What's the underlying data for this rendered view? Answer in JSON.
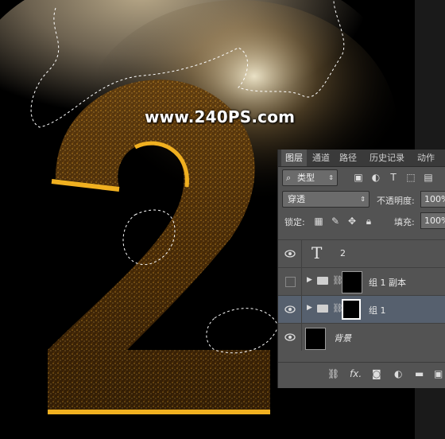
{
  "watermark": "www.240PS.com",
  "panel": {
    "tabs": [
      "图层",
      "通道",
      "路径",
      "历史记录",
      "动作"
    ],
    "filter_label": "类型",
    "blend_mode": "穿透",
    "opacity_label": "不透明度:",
    "opacity_value": "100%",
    "lock_label": "锁定:",
    "fill_label": "填充:",
    "fill_value": "100%",
    "layers": [
      {
        "name": "2",
        "kind": "text",
        "visible": true
      },
      {
        "name": "组 1 副本",
        "kind": "group",
        "visible": false
      },
      {
        "name": "组 1",
        "kind": "group",
        "visible": true,
        "selected": true
      },
      {
        "name": "背景",
        "kind": "background",
        "visible": true
      }
    ],
    "footer_icons": [
      "link-icon",
      "fx-icon",
      "mask-icon",
      "adjustment-icon",
      "folder-icon",
      "new-layer-icon"
    ]
  },
  "colors": {
    "panel_bg": "#535353",
    "selected_layer": "#56606e",
    "gold": "#e8a21c"
  }
}
